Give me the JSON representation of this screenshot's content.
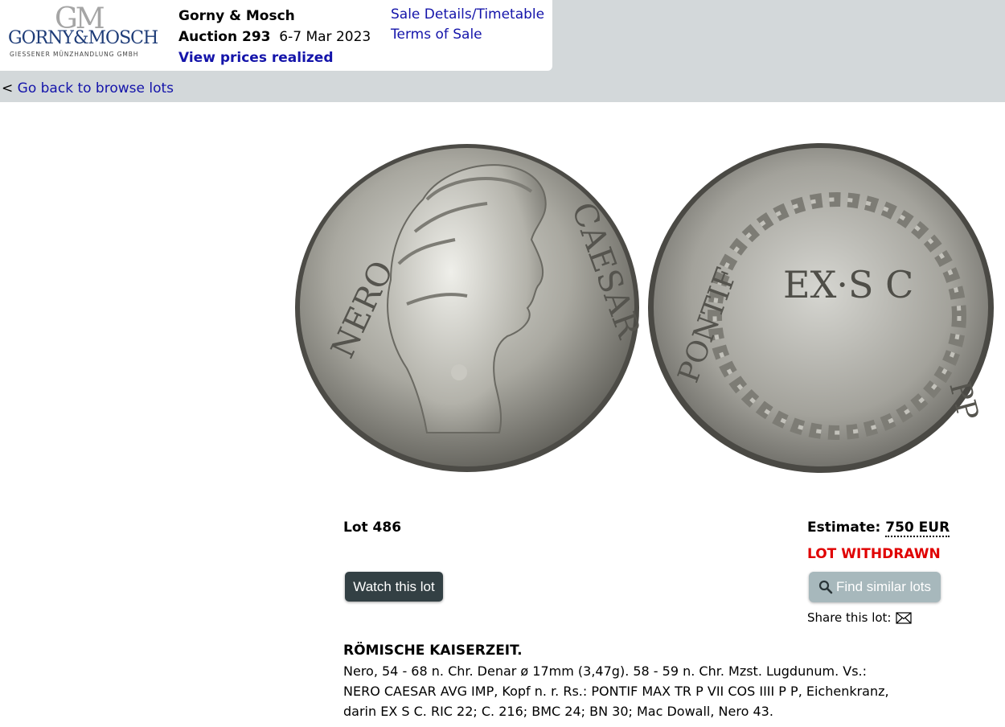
{
  "logo": {
    "monogram": "GM",
    "name": "GORNY&MOSCH",
    "subtitle": "GIESSENER MÜNZHANDLUNG GMBH"
  },
  "header": {
    "house": "Gorny & Mosch",
    "auction_label": "Auction 293",
    "auction_dates": "6-7 Mar 2023",
    "prices_link": "View prices realized",
    "sale_details_link": "Sale Details/Timetable",
    "terms_link": "Terms of Sale"
  },
  "nav": {
    "back_prefix": "<",
    "back_link": "Go back to browse lots"
  },
  "coin": {
    "obverse_legend_left": "NERO",
    "obverse_legend_right": "CAESAR",
    "reverse_inscription": "EX·S C",
    "reverse_legend_left": "PONTIF",
    "reverse_legend_right": "PP"
  },
  "lot": {
    "title": "Lot 486",
    "estimate_label": "Estimate:",
    "estimate_value": "750 EUR",
    "status": "LOT WITHDRAWN",
    "watch_button": "Watch this lot",
    "similar_button": "Find similar lots",
    "share_label": "Share this lot:"
  },
  "description": {
    "heading": "RÖMISCHE KAISERZEIT.",
    "line1": "Nero, 54 - 68 n. Chr. Denar ø 17mm (3,47g). 58 - 59 n. Chr. Mzst. Lugdunum. Vs.:",
    "line2": "NERO CAESAR AVG IMP, Kopf n. r. Rs.: PONTIF MAX TR P VII COS IIII P P, Eichenkranz,",
    "line3": "darin EX S C. RIC 22; C. 216; BMC 24; BN 30; Mac Dowall, Nero 43."
  },
  "colors": {
    "link": "#1414aa",
    "withdrawn": "#e00000",
    "band": "#d3d8da",
    "watch_button": "#334044",
    "similar_button": "#a7b8bc"
  },
  "icons": {
    "search": "magnifier-icon",
    "share": "envelope-icon"
  }
}
